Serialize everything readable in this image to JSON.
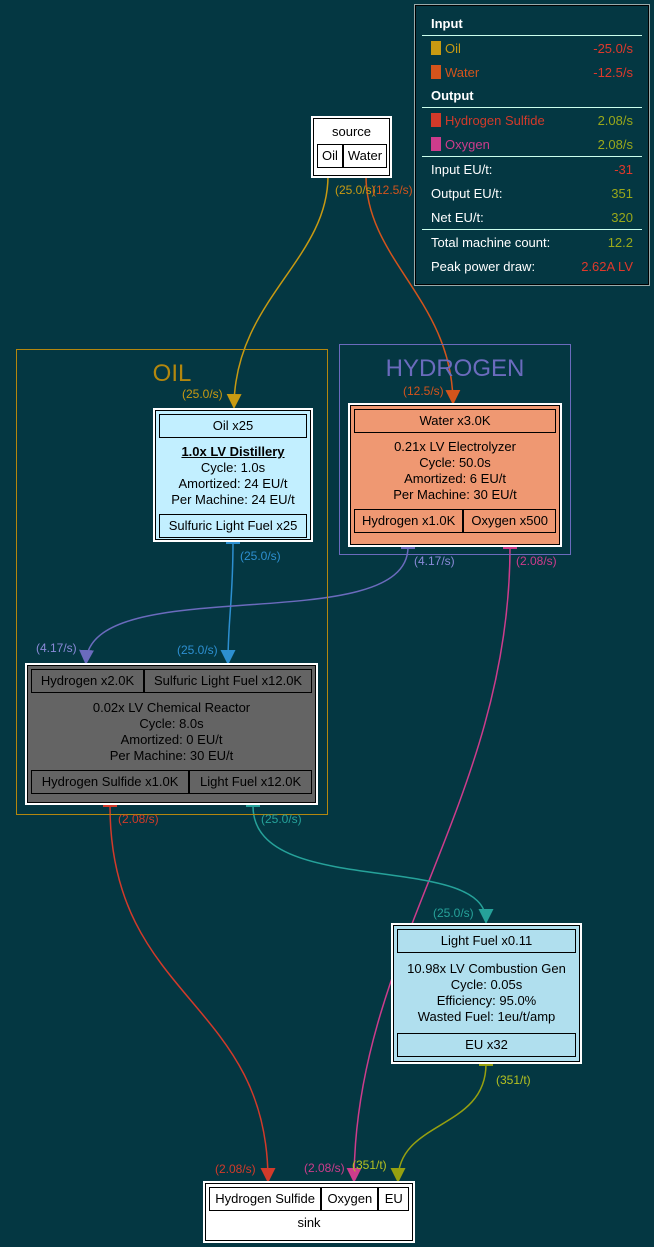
{
  "colors": {
    "background": "#043742",
    "oil": "#c89a12",
    "water": "#d3541c",
    "hydrogen": "#6b6bbd",
    "sulfuric_light_fuel": "#2d8fd0",
    "hydrogen_sulfide": "#d23a2a",
    "oxygen": "#cd3c8c",
    "light_fuel": "#26a29a",
    "eu": "#96a010",
    "red_value": "#e0392b",
    "green_value": "#9aa81a"
  },
  "legend": {
    "input_header": "Input",
    "output_header": "Output",
    "inputs": [
      {
        "name": "Oil",
        "rate": "-25.0/s"
      },
      {
        "name": "Water",
        "rate": "-12.5/s"
      }
    ],
    "outputs": [
      {
        "name": "Hydrogen Sulfide",
        "rate": "2.08/s"
      },
      {
        "name": "Oxygen",
        "rate": "2.08/s"
      }
    ],
    "stats": [
      {
        "label": "Input EU/t:",
        "value": "-31"
      },
      {
        "label": "Output EU/t:",
        "value": "351"
      },
      {
        "label": "Net EU/t:",
        "value": "320"
      },
      {
        "label": "Total machine count:",
        "value": "12.2"
      },
      {
        "label": "Peak power draw:",
        "value": "2.62A LV"
      }
    ]
  },
  "clusters": {
    "oil": "OIL",
    "hydrogen": "HYDROGEN"
  },
  "nodes": {
    "source": {
      "title": "source",
      "ports": [
        "Oil",
        "Water"
      ]
    },
    "distillery": {
      "input": "Oil x25",
      "title": "1.0x LV Distillery",
      "lines": [
        "Cycle: 1.0s",
        "Amortized: 24 EU/t",
        "Per Machine: 24 EU/t"
      ],
      "output": "Sulfuric Light Fuel x25"
    },
    "electrolyzer": {
      "input": "Water x3.0K",
      "lines": [
        "0.21x LV Electrolyzer",
        "Cycle: 50.0s",
        "Amortized: 6 EU/t",
        "Per Machine: 30 EU/t"
      ],
      "outputs": [
        "Hydrogen x1.0K",
        "Oxygen x500"
      ]
    },
    "reactor": {
      "inputs": [
        "Hydrogen x2.0K",
        "Sulfuric Light Fuel x12.0K"
      ],
      "lines": [
        "0.02x LV Chemical Reactor",
        "Cycle: 8.0s",
        "Amortized: 0 EU/t",
        "Per Machine: 30 EU/t"
      ],
      "outputs": [
        "Hydrogen Sulfide x1.0K",
        "Light Fuel x12.0K"
      ]
    },
    "generator": {
      "input": "Light Fuel x0.11",
      "lines": [
        "10.98x LV Combustion Gen",
        "Cycle: 0.05s",
        "Efficiency: 95.0%",
        "Wasted Fuel: 1eu/t/amp"
      ],
      "output": "EU x32"
    },
    "sink": {
      "ports": [
        "Hydrogen Sulfide",
        "Oxygen",
        "EU"
      ],
      "title": "sink"
    }
  },
  "edge_labels": {
    "oil_src": "(25.0/s)",
    "water_src": "(12.5/s)",
    "oil_dst": "(25.0/s)",
    "water_dst": "(12.5/s)",
    "slf_src": "(25.0/s)",
    "slf_dst": "(25.0/s)",
    "h2_src": "(4.17/s)",
    "h2_dst": "(4.17/s)",
    "o2_src": "(2.08/s)",
    "o2_dst": "(2.08/s)",
    "h2s_src": "(2.08/s)",
    "h2s_dst": "(2.08/s)",
    "lf_src": "(25.0/s)",
    "lf_dst": "(25.0/s)",
    "eu_src": "(351/t)",
    "eu_dst": "(351/t)"
  }
}
